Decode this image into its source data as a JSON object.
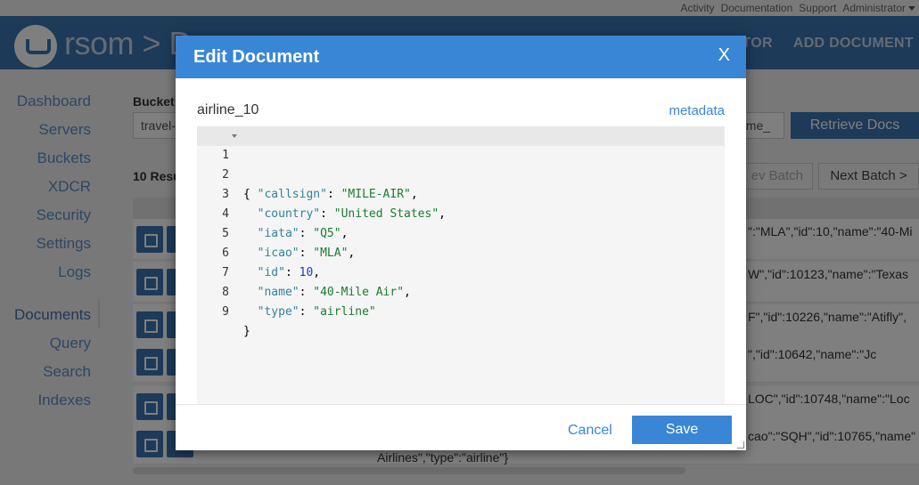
{
  "topbar": {
    "links": [
      "Activity",
      "Documentation",
      "Support",
      "Administrator"
    ]
  },
  "header": {
    "brand": "rsom > D",
    "nav": [
      "ITOR",
      "ADD DOCUMENT"
    ]
  },
  "sidebar": {
    "items": [
      {
        "label": "Dashboard"
      },
      {
        "label": "Servers"
      },
      {
        "label": "Buckets"
      },
      {
        "label": "XDCR"
      },
      {
        "label": "Security"
      },
      {
        "label": "Settings"
      },
      {
        "label": "Logs"
      },
      {
        "label": "Documents"
      },
      {
        "label": "Query"
      },
      {
        "label": "Search"
      },
      {
        "label": "Indexes"
      }
    ]
  },
  "main": {
    "bucket_label": "Bucket",
    "bucket_value": "travel-",
    "results_label": "10 Resu",
    "docid_value": "ome_",
    "retrieve_label": "Retrieve Docs",
    "prev_label": "ev Batch",
    "next_label": "Next Batch >",
    "rows": [
      {
        "json": "\":\"MLA\",\"id\":10,\"name\":\"40-Mi"
      },
      {
        "json": "W\",\"id\":10123,\"name\":\"Texas"
      },
      {
        "json": "F\",\"id\":10226,\"name\":\"Atifly\","
      },
      {
        "json": "\",\"id\":10642,\"name\":\"Jc"
      },
      {
        "json": "LOC\",\"id\":10748,\"name\":\"Loc"
      },
      {
        "json": "cao\":\"SQH\",\"id\":10765,\"name\""
      }
    ],
    "tail_text": "Airlines\",\"type\":\"airline\"}"
  },
  "modal": {
    "title": "Edit Document",
    "close": "X",
    "doc_id": "airline_10",
    "metadata_label": "metadata",
    "cancel_label": "Cancel",
    "save_label": "Save",
    "line_numbers": [
      "1",
      "2",
      "3",
      "4",
      "5",
      "6",
      "7",
      "8",
      "9"
    ],
    "code": [
      {
        "key": "callsign",
        "value": "\"MILE-AIR\""
      },
      {
        "key": "country",
        "value": "\"United States\""
      },
      {
        "key": "iata",
        "value": "\"Q5\""
      },
      {
        "key": "icao",
        "value": "\"MLA\""
      },
      {
        "key": "id",
        "value": "10"
      },
      {
        "key": "name",
        "value": "\"40-Mile Air\""
      },
      {
        "key": "type",
        "value": "\"airline\""
      }
    ],
    "open_brace": "{",
    "close_brace": "}"
  }
}
